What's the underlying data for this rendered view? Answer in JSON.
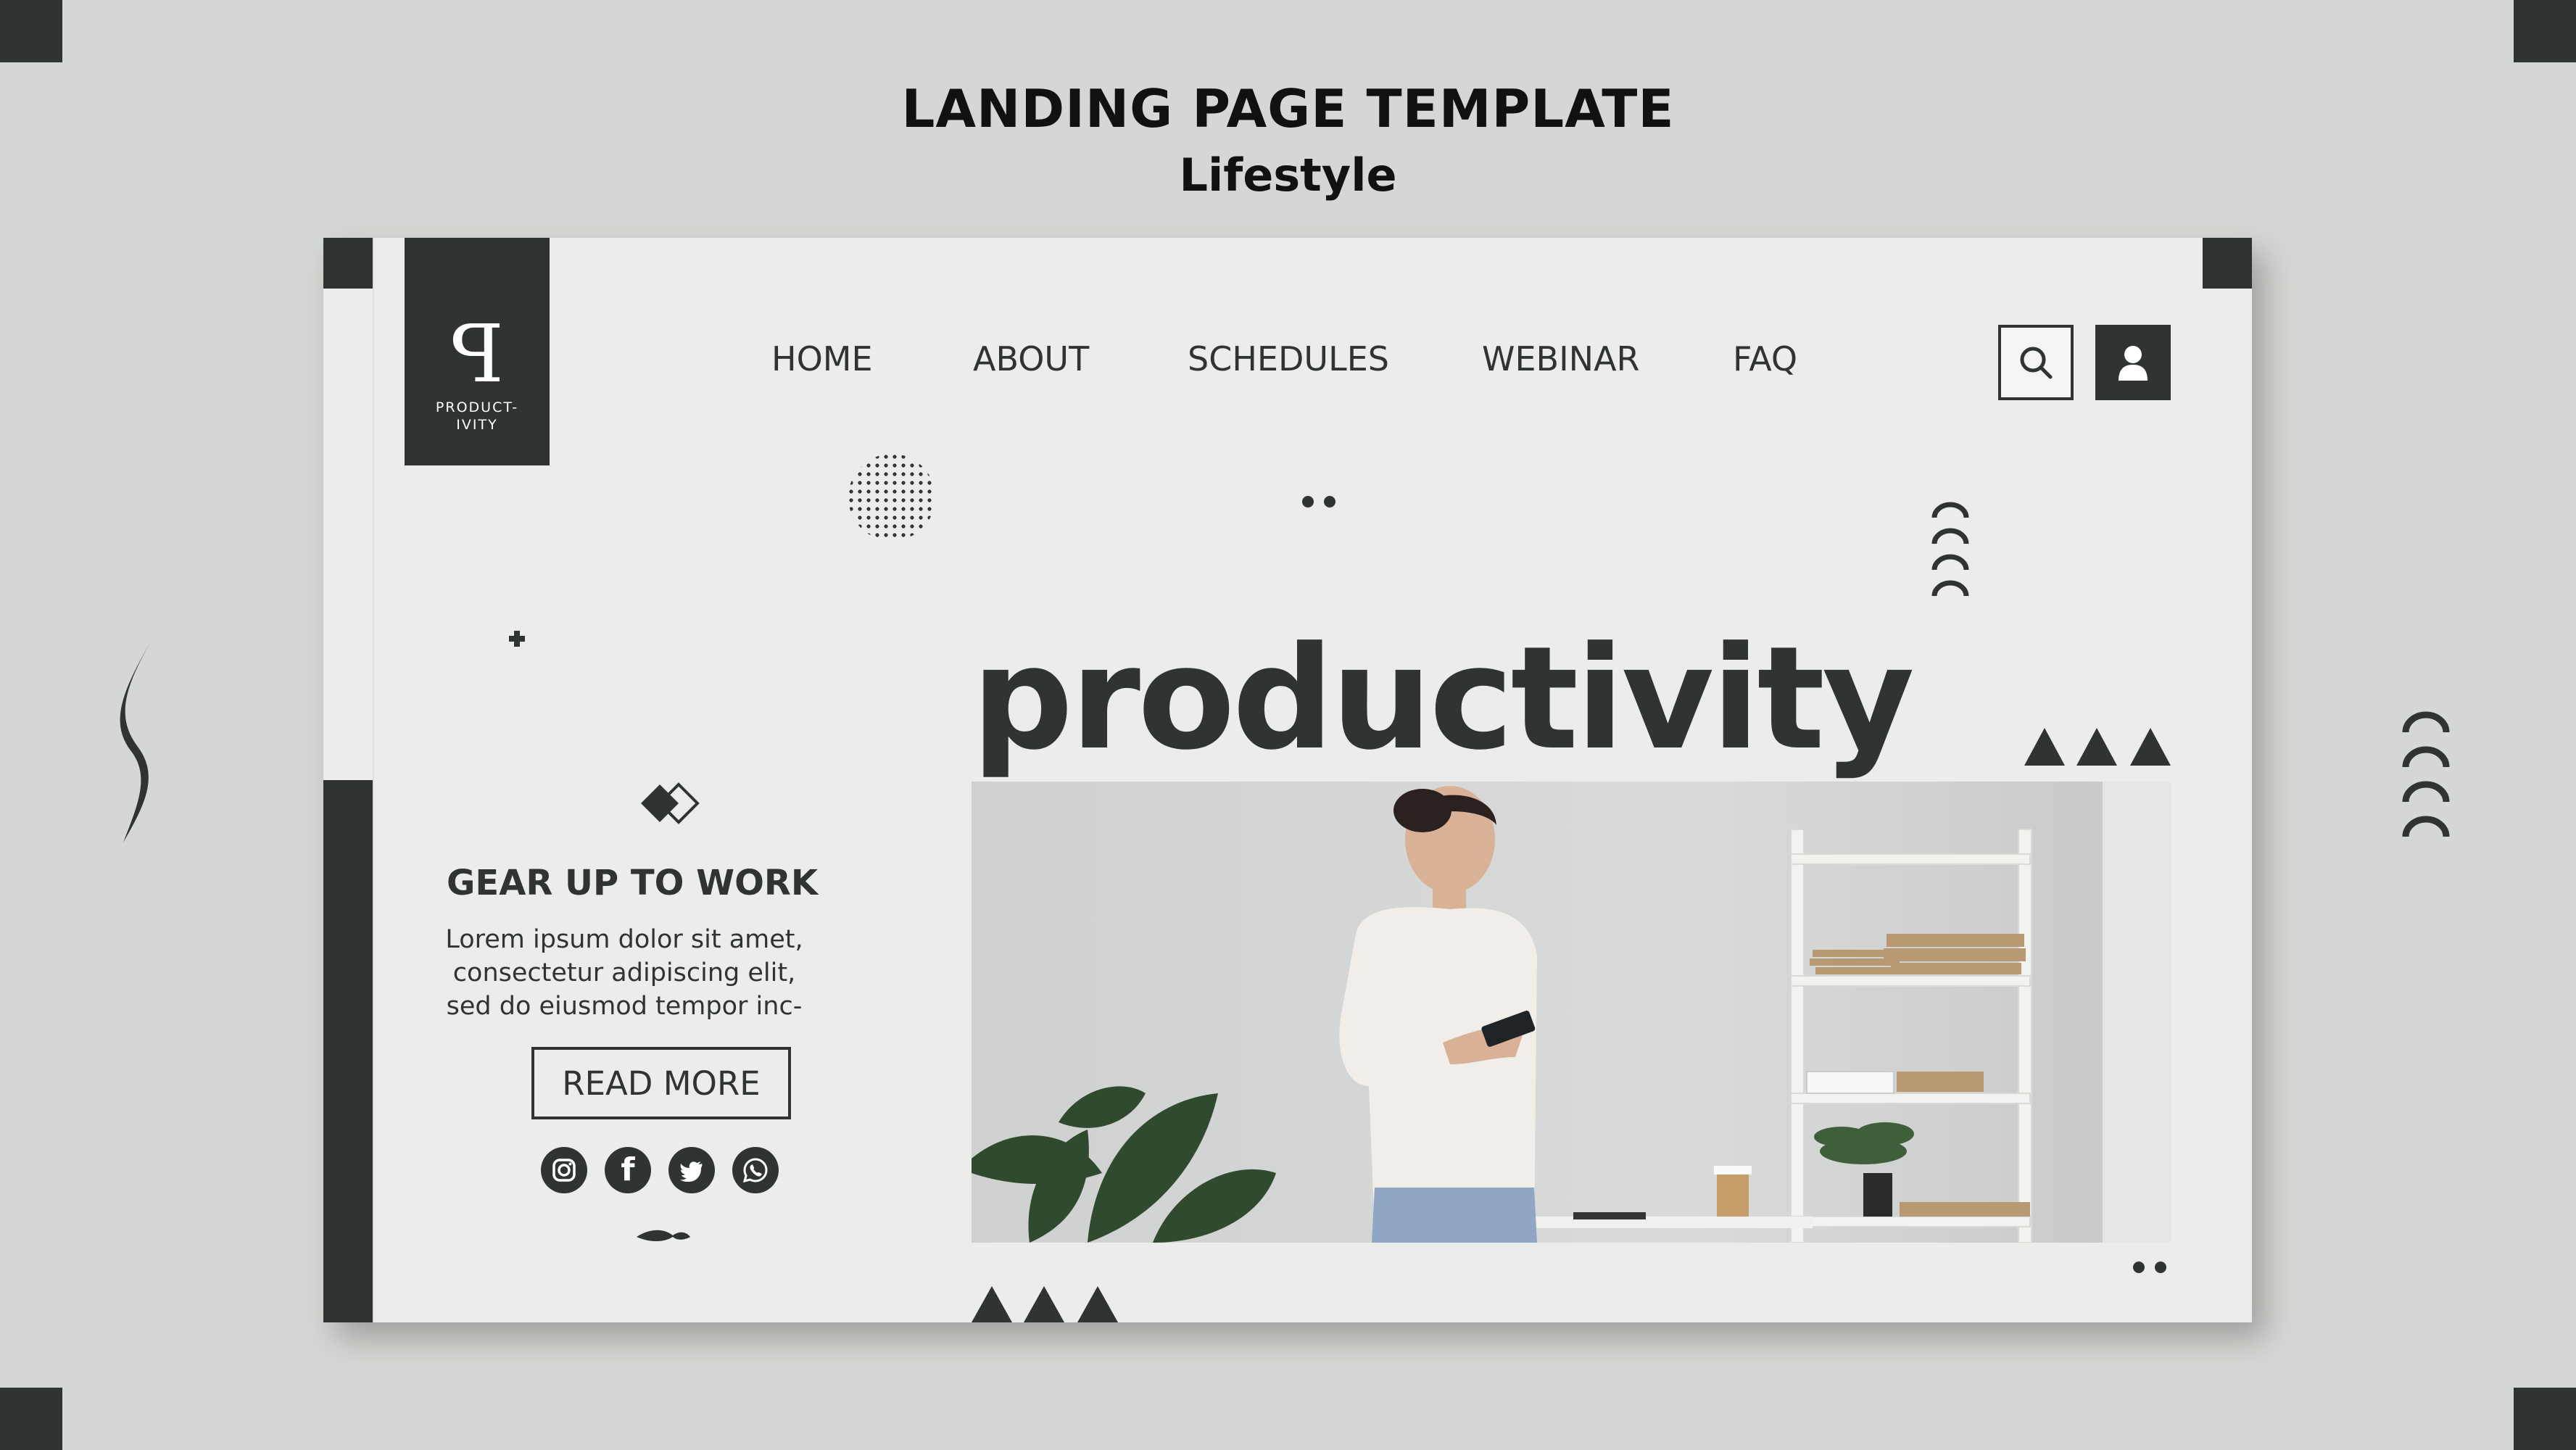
{
  "header": {
    "title": "LANDING PAGE TEMPLATE",
    "subtitle": "Lifestyle"
  },
  "logo": {
    "mark": "ꟼ",
    "text_line1": "PRODUCT-",
    "text_line2": "IVITY"
  },
  "nav": {
    "items": [
      {
        "label": "HOME"
      },
      {
        "label": "ABOUT"
      },
      {
        "label": "SCHEDULES"
      },
      {
        "label": "WEBINAR"
      },
      {
        "label": "FAQ"
      }
    ]
  },
  "hero": {
    "headline": "productivity"
  },
  "promo": {
    "title": "GEAR UP TO WORK",
    "body_line1": "Lorem ipsum dolor sit amet,",
    "body_line2": "consectetur adipiscing elit,",
    "body_line3": "sed do eiusmod tempor inc-",
    "cta_label": "READ MORE"
  },
  "social": {
    "icons": [
      "instagram-icon",
      "facebook-icon",
      "twitter-icon",
      "whatsapp-icon"
    ],
    "facebook_glyph": "f"
  },
  "colors": {
    "background": "#d5d7d4",
    "card": "#ecedeb",
    "accent_dark": "#2f3430"
  }
}
